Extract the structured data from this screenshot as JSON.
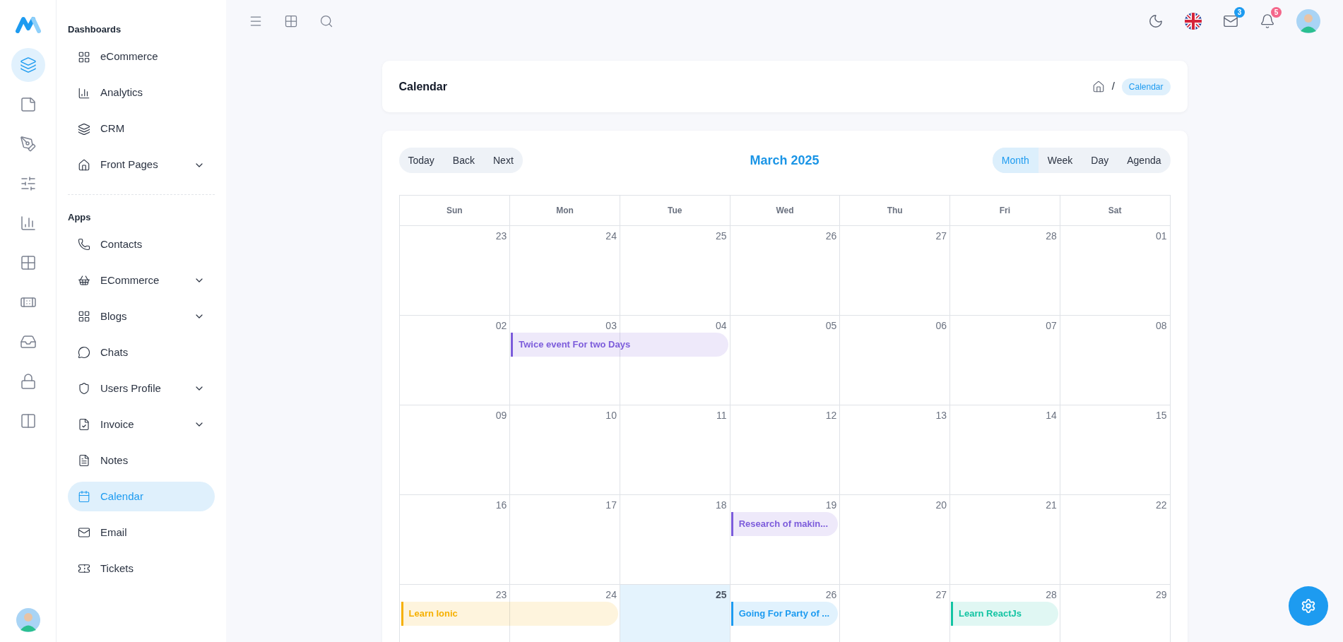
{
  "rail": [
    {
      "selected": true
    },
    {
      "selected": false
    },
    {
      "selected": false
    },
    {
      "selected": false
    },
    {
      "selected": false
    },
    {
      "selected": false
    },
    {
      "selected": false
    },
    {
      "selected": false
    },
    {
      "selected": false
    },
    {
      "selected": false
    }
  ],
  "sidebar": {
    "sections": [
      {
        "title": "Dashboards",
        "items": [
          {
            "label": "eCommerce",
            "expandable": false,
            "selected": false
          },
          {
            "label": "Analytics",
            "expandable": false,
            "selected": false
          },
          {
            "label": "CRM",
            "expandable": false,
            "selected": false
          },
          {
            "label": "Front Pages",
            "expandable": true,
            "selected": false
          }
        ]
      },
      {
        "title": "Apps",
        "items": [
          {
            "label": "Contacts",
            "expandable": false,
            "selected": false
          },
          {
            "label": "ECommerce",
            "expandable": true,
            "selected": false
          },
          {
            "label": "Blogs",
            "expandable": true,
            "selected": false
          },
          {
            "label": "Chats",
            "expandable": false,
            "selected": false
          },
          {
            "label": "Users Profile",
            "expandable": true,
            "selected": false
          },
          {
            "label": "Invoice",
            "expandable": true,
            "selected": false
          },
          {
            "label": "Notes",
            "expandable": false,
            "selected": false
          },
          {
            "label": "Calendar",
            "expandable": false,
            "selected": true
          },
          {
            "label": "Email",
            "expandable": false,
            "selected": false
          },
          {
            "label": "Tickets",
            "expandable": false,
            "selected": false
          }
        ]
      }
    ]
  },
  "topbar": {
    "messages_badge": "3",
    "notifications_badge": "5"
  },
  "header": {
    "title": "Calendar",
    "separator": "/",
    "current": "Calendar"
  },
  "toolbar": {
    "nav": [
      "Today",
      "Back",
      "Next"
    ],
    "title": "March 2025",
    "views": [
      {
        "label": "Month",
        "selected": true
      },
      {
        "label": "Week",
        "selected": false
      },
      {
        "label": "Day",
        "selected": false
      },
      {
        "label": "Agenda",
        "selected": false
      }
    ]
  },
  "weekdays": [
    "Sun",
    "Mon",
    "Tue",
    "Wed",
    "Thu",
    "Fri",
    "Sat"
  ],
  "weeks": [
    {
      "days": [
        {
          "date": "23",
          "today": false
        },
        {
          "date": "24",
          "today": false
        },
        {
          "date": "25",
          "today": false
        },
        {
          "date": "26",
          "today": false
        },
        {
          "date": "27",
          "today": false
        },
        {
          "date": "28",
          "today": false
        },
        {
          "date": "01",
          "today": false
        }
      ]
    },
    {
      "days": [
        {
          "date": "02",
          "today": false
        },
        {
          "date": "03",
          "today": false,
          "events": [
            {
              "title": "Twice event For two Days",
              "color": "#7c5cdb",
              "continues": true
            }
          ]
        },
        {
          "date": "04",
          "today": false
        },
        {
          "date": "05",
          "today": false
        },
        {
          "date": "06",
          "today": false
        },
        {
          "date": "07",
          "today": false
        },
        {
          "date": "08",
          "today": false
        }
      ]
    },
    {
      "days": [
        {
          "date": "09",
          "today": false
        },
        {
          "date": "10",
          "today": false
        },
        {
          "date": "11",
          "today": false
        },
        {
          "date": "12",
          "today": false
        },
        {
          "date": "13",
          "today": false
        },
        {
          "date": "14",
          "today": false
        },
        {
          "date": "15",
          "today": false
        }
      ]
    },
    {
      "days": [
        {
          "date": "16",
          "today": false
        },
        {
          "date": "17",
          "today": false
        },
        {
          "date": "18",
          "today": false
        },
        {
          "date": "19",
          "today": false,
          "events": [
            {
              "title": "Research of makin...",
              "color": "#7c5cdb",
              "continues": false
            }
          ]
        },
        {
          "date": "20",
          "today": false
        },
        {
          "date": "21",
          "today": false
        },
        {
          "date": "22",
          "today": false
        }
      ]
    },
    {
      "days": [
        {
          "date": "23",
          "today": false,
          "events": [
            {
              "title": "Learn Ionic",
              "color": "#f6b000",
              "continues": true
            }
          ]
        },
        {
          "date": "24",
          "today": false
        },
        {
          "date": "25",
          "today": true
        },
        {
          "date": "26",
          "today": false,
          "events": [
            {
              "title": "Going For Party of ...",
              "color": "#1d9bf0",
              "continues": false
            }
          ]
        },
        {
          "date": "27",
          "today": false
        },
        {
          "date": "28",
          "today": false,
          "events": [
            {
              "title": "Learn ReactJs",
              "color": "#13c4a3",
              "continues": false
            }
          ]
        },
        {
          "date": "29",
          "today": false
        }
      ]
    }
  ]
}
